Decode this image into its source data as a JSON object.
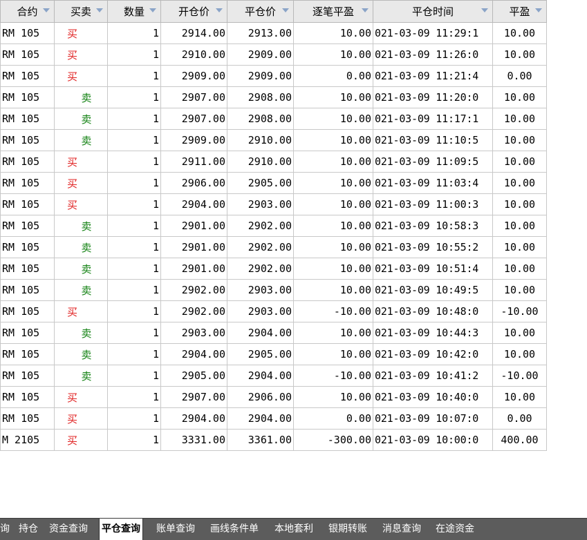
{
  "columns": [
    {
      "label": "合约"
    },
    {
      "label": "买卖"
    },
    {
      "label": "数量"
    },
    {
      "label": "开仓价"
    },
    {
      "label": "平仓价"
    },
    {
      "label": "逐笔平盈"
    },
    {
      "label": "平仓时间"
    },
    {
      "label": "平盈"
    }
  ],
  "rows": [
    {
      "contract": "RM 105",
      "side": "买",
      "side_type": "buy",
      "qty": "1",
      "open": "2914.00",
      "close": "2913.00",
      "pnl": "10.00",
      "time": "021-03-09 11:29:1",
      "profit": "10.00"
    },
    {
      "contract": "RM 105",
      "side": "买",
      "side_type": "buy",
      "qty": "1",
      "open": "2910.00",
      "close": "2909.00",
      "pnl": "10.00",
      "time": "021-03-09 11:26:0",
      "profit": "10.00"
    },
    {
      "contract": "RM 105",
      "side": "买",
      "side_type": "buy",
      "qty": "1",
      "open": "2909.00",
      "close": "2909.00",
      "pnl": "0.00",
      "time": "021-03-09 11:21:4",
      "profit": "0.00"
    },
    {
      "contract": "RM 105",
      "side": "卖",
      "side_type": "sell",
      "qty": "1",
      "open": "2907.00",
      "close": "2908.00",
      "pnl": "10.00",
      "time": "021-03-09 11:20:0",
      "profit": "10.00"
    },
    {
      "contract": "RM 105",
      "side": "卖",
      "side_type": "sell",
      "qty": "1",
      "open": "2907.00",
      "close": "2908.00",
      "pnl": "10.00",
      "time": "021-03-09 11:17:1",
      "profit": "10.00"
    },
    {
      "contract": "RM 105",
      "side": "卖",
      "side_type": "sell",
      "qty": "1",
      "open": "2909.00",
      "close": "2910.00",
      "pnl": "10.00",
      "time": "021-03-09 11:10:5",
      "profit": "10.00"
    },
    {
      "contract": "RM 105",
      "side": "买",
      "side_type": "buy",
      "qty": "1",
      "open": "2911.00",
      "close": "2910.00",
      "pnl": "10.00",
      "time": "021-03-09 11:09:5",
      "profit": "10.00"
    },
    {
      "contract": "RM 105",
      "side": "买",
      "side_type": "buy",
      "qty": "1",
      "open": "2906.00",
      "close": "2905.00",
      "pnl": "10.00",
      "time": "021-03-09 11:03:4",
      "profit": "10.00"
    },
    {
      "contract": "RM 105",
      "side": "买",
      "side_type": "buy",
      "qty": "1",
      "open": "2904.00",
      "close": "2903.00",
      "pnl": "10.00",
      "time": "021-03-09 11:00:3",
      "profit": "10.00"
    },
    {
      "contract": "RM 105",
      "side": "卖",
      "side_type": "sell",
      "qty": "1",
      "open": "2901.00",
      "close": "2902.00",
      "pnl": "10.00",
      "time": "021-03-09 10:58:3",
      "profit": "10.00"
    },
    {
      "contract": "RM 105",
      "side": "卖",
      "side_type": "sell",
      "qty": "1",
      "open": "2901.00",
      "close": "2902.00",
      "pnl": "10.00",
      "time": "021-03-09 10:55:2",
      "profit": "10.00"
    },
    {
      "contract": "RM 105",
      "side": "卖",
      "side_type": "sell",
      "qty": "1",
      "open": "2901.00",
      "close": "2902.00",
      "pnl": "10.00",
      "time": "021-03-09 10:51:4",
      "profit": "10.00"
    },
    {
      "contract": "RM 105",
      "side": "卖",
      "side_type": "sell",
      "qty": "1",
      "open": "2902.00",
      "close": "2903.00",
      "pnl": "10.00",
      "time": "021-03-09 10:49:5",
      "profit": "10.00"
    },
    {
      "contract": "RM 105",
      "side": "买",
      "side_type": "buy",
      "qty": "1",
      "open": "2902.00",
      "close": "2903.00",
      "pnl": "-10.00",
      "time": "021-03-09 10:48:0",
      "profit": "-10.00"
    },
    {
      "contract": "RM 105",
      "side": "卖",
      "side_type": "sell",
      "qty": "1",
      "open": "2903.00",
      "close": "2904.00",
      "pnl": "10.00",
      "time": "021-03-09 10:44:3",
      "profit": "10.00"
    },
    {
      "contract": "RM 105",
      "side": "卖",
      "side_type": "sell",
      "qty": "1",
      "open": "2904.00",
      "close": "2905.00",
      "pnl": "10.00",
      "time": "021-03-09 10:42:0",
      "profit": "10.00"
    },
    {
      "contract": "RM 105",
      "side": "卖",
      "side_type": "sell",
      "qty": "1",
      "open": "2905.00",
      "close": "2904.00",
      "pnl": "-10.00",
      "time": "021-03-09 10:41:2",
      "profit": "-10.00"
    },
    {
      "contract": "RM 105",
      "side": "买",
      "side_type": "buy",
      "qty": "1",
      "open": "2907.00",
      "close": "2906.00",
      "pnl": "10.00",
      "time": "021-03-09 10:40:0",
      "profit": "10.00"
    },
    {
      "contract": "RM 105",
      "side": "买",
      "side_type": "buy",
      "qty": "1",
      "open": "2904.00",
      "close": "2904.00",
      "pnl": "0.00",
      "time": "021-03-09 10:07:0",
      "profit": "0.00"
    },
    {
      "contract": "M 2105",
      "side": "买",
      "side_type": "buy",
      "qty": "1",
      "open": "3331.00",
      "close": "3361.00",
      "pnl": "-300.00",
      "time": "021-03-09 10:00:0",
      "profit": "400.00"
    }
  ],
  "tabs": [
    {
      "label": "询",
      "active": false
    },
    {
      "label": "持仓",
      "active": false
    },
    {
      "label": "资金查询",
      "active": false
    },
    {
      "label": "平仓查询",
      "active": true
    },
    {
      "label": "账单查询",
      "active": false
    },
    {
      "label": "画线条件单",
      "active": false
    },
    {
      "label": "本地套利",
      "active": false
    },
    {
      "label": "银期转账",
      "active": false
    },
    {
      "label": "消息查询",
      "active": false
    },
    {
      "label": "在途资金",
      "active": false
    }
  ],
  "colors": {
    "buy": "#e02020",
    "sell": "#108010",
    "tabbar": "#5c5c5c",
    "header": "#e9e9e9"
  }
}
